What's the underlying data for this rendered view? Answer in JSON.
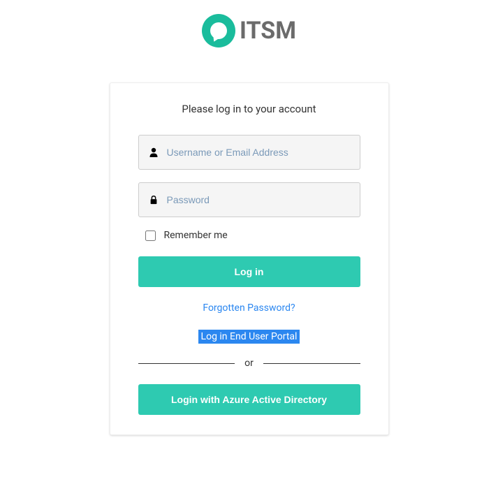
{
  "logo": {
    "text": "ITSM"
  },
  "login": {
    "title": "Please log in to your account",
    "username_placeholder": "Username or Email Address",
    "password_placeholder": "Password",
    "remember_label": "Remember me",
    "login_button": "Log in",
    "forgot_password": "Forgotten Password?",
    "end_user_portal": "Log in End User Portal",
    "divider_text": "or",
    "azure_button": "Login with Azure Active Directory"
  }
}
